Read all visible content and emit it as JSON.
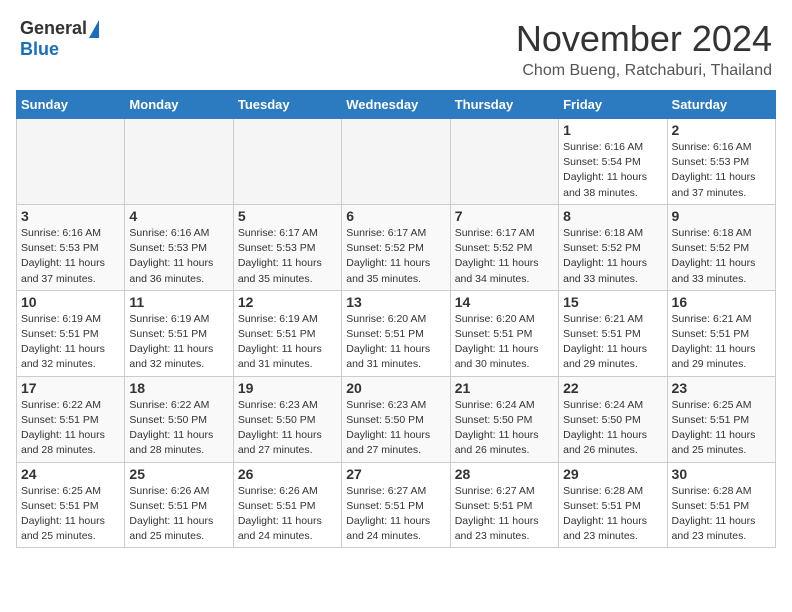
{
  "header": {
    "logo_general": "General",
    "logo_blue": "Blue",
    "month_title": "November 2024",
    "location": "Chom Bueng, Ratchaburi, Thailand"
  },
  "days_of_week": [
    "Sunday",
    "Monday",
    "Tuesday",
    "Wednesday",
    "Thursday",
    "Friday",
    "Saturday"
  ],
  "weeks": [
    [
      {
        "day": "",
        "empty": true
      },
      {
        "day": "",
        "empty": true
      },
      {
        "day": "",
        "empty": true
      },
      {
        "day": "",
        "empty": true
      },
      {
        "day": "",
        "empty": true
      },
      {
        "day": "1",
        "sunrise": "6:16 AM",
        "sunset": "5:54 PM",
        "daylight": "11 hours and 38 minutes."
      },
      {
        "day": "2",
        "sunrise": "6:16 AM",
        "sunset": "5:53 PM",
        "daylight": "11 hours and 37 minutes."
      }
    ],
    [
      {
        "day": "3",
        "sunrise": "6:16 AM",
        "sunset": "5:53 PM",
        "daylight": "11 hours and 37 minutes."
      },
      {
        "day": "4",
        "sunrise": "6:16 AM",
        "sunset": "5:53 PM",
        "daylight": "11 hours and 36 minutes."
      },
      {
        "day": "5",
        "sunrise": "6:17 AM",
        "sunset": "5:53 PM",
        "daylight": "11 hours and 35 minutes."
      },
      {
        "day": "6",
        "sunrise": "6:17 AM",
        "sunset": "5:52 PM",
        "daylight": "11 hours and 35 minutes."
      },
      {
        "day": "7",
        "sunrise": "6:17 AM",
        "sunset": "5:52 PM",
        "daylight": "11 hours and 34 minutes."
      },
      {
        "day": "8",
        "sunrise": "6:18 AM",
        "sunset": "5:52 PM",
        "daylight": "11 hours and 33 minutes."
      },
      {
        "day": "9",
        "sunrise": "6:18 AM",
        "sunset": "5:52 PM",
        "daylight": "11 hours and 33 minutes."
      }
    ],
    [
      {
        "day": "10",
        "sunrise": "6:19 AM",
        "sunset": "5:51 PM",
        "daylight": "11 hours and 32 minutes."
      },
      {
        "day": "11",
        "sunrise": "6:19 AM",
        "sunset": "5:51 PM",
        "daylight": "11 hours and 32 minutes."
      },
      {
        "day": "12",
        "sunrise": "6:19 AM",
        "sunset": "5:51 PM",
        "daylight": "11 hours and 31 minutes."
      },
      {
        "day": "13",
        "sunrise": "6:20 AM",
        "sunset": "5:51 PM",
        "daylight": "11 hours and 31 minutes."
      },
      {
        "day": "14",
        "sunrise": "6:20 AM",
        "sunset": "5:51 PM",
        "daylight": "11 hours and 30 minutes."
      },
      {
        "day": "15",
        "sunrise": "6:21 AM",
        "sunset": "5:51 PM",
        "daylight": "11 hours and 29 minutes."
      },
      {
        "day": "16",
        "sunrise": "6:21 AM",
        "sunset": "5:51 PM",
        "daylight": "11 hours and 29 minutes."
      }
    ],
    [
      {
        "day": "17",
        "sunrise": "6:22 AM",
        "sunset": "5:51 PM",
        "daylight": "11 hours and 28 minutes."
      },
      {
        "day": "18",
        "sunrise": "6:22 AM",
        "sunset": "5:50 PM",
        "daylight": "11 hours and 28 minutes."
      },
      {
        "day": "19",
        "sunrise": "6:23 AM",
        "sunset": "5:50 PM",
        "daylight": "11 hours and 27 minutes."
      },
      {
        "day": "20",
        "sunrise": "6:23 AM",
        "sunset": "5:50 PM",
        "daylight": "11 hours and 27 minutes."
      },
      {
        "day": "21",
        "sunrise": "6:24 AM",
        "sunset": "5:50 PM",
        "daylight": "11 hours and 26 minutes."
      },
      {
        "day": "22",
        "sunrise": "6:24 AM",
        "sunset": "5:50 PM",
        "daylight": "11 hours and 26 minutes."
      },
      {
        "day": "23",
        "sunrise": "6:25 AM",
        "sunset": "5:51 PM",
        "daylight": "11 hours and 25 minutes."
      }
    ],
    [
      {
        "day": "24",
        "sunrise": "6:25 AM",
        "sunset": "5:51 PM",
        "daylight": "11 hours and 25 minutes."
      },
      {
        "day": "25",
        "sunrise": "6:26 AM",
        "sunset": "5:51 PM",
        "daylight": "11 hours and 25 minutes."
      },
      {
        "day": "26",
        "sunrise": "6:26 AM",
        "sunset": "5:51 PM",
        "daylight": "11 hours and 24 minutes."
      },
      {
        "day": "27",
        "sunrise": "6:27 AM",
        "sunset": "5:51 PM",
        "daylight": "11 hours and 24 minutes."
      },
      {
        "day": "28",
        "sunrise": "6:27 AM",
        "sunset": "5:51 PM",
        "daylight": "11 hours and 23 minutes."
      },
      {
        "day": "29",
        "sunrise": "6:28 AM",
        "sunset": "5:51 PM",
        "daylight": "11 hours and 23 minutes."
      },
      {
        "day": "30",
        "sunrise": "6:28 AM",
        "sunset": "5:51 PM",
        "daylight": "11 hours and 23 minutes."
      }
    ]
  ]
}
